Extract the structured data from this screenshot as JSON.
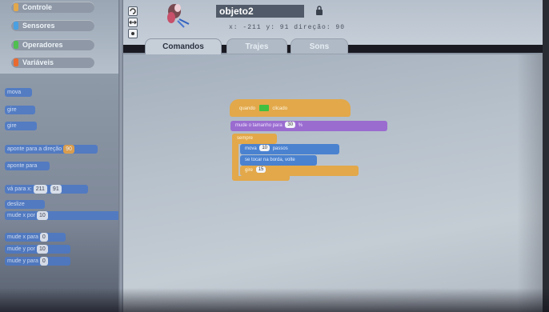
{
  "palette": {
    "categories": [
      {
        "label": "Controle",
        "color": "#e2a84a"
      },
      {
        "label": "Sensores",
        "color": "#4aa0e0"
      },
      {
        "label": "Operadores",
        "color": "#50c050"
      },
      {
        "label": "Variáveis",
        "color": "#e86a30"
      }
    ],
    "blocks": [
      {
        "label": "mova"
      },
      {
        "label": "gire"
      },
      {
        "label": "gire"
      },
      {
        "label": "aponte para a direção",
        "value": "90"
      },
      {
        "label": "aponte para"
      },
      {
        "label": "vá para x:",
        "value": "211",
        "value2": "91"
      },
      {
        "label": "deslize"
      },
      {
        "label": "mude x por",
        "value": "10"
      },
      {
        "label": "mude x para",
        "value": "0"
      },
      {
        "label": "mude y por",
        "value": "10"
      },
      {
        "label": "mude y para",
        "value": "0"
      }
    ]
  },
  "header": {
    "sprite_name": "objeto2",
    "coords_text": "x: -211  y: 91   direção: 90"
  },
  "tabs": [
    {
      "label": "Comandos",
      "active": true
    },
    {
      "label": "Trajes",
      "active": false
    },
    {
      "label": "Sons",
      "active": false
    }
  ],
  "script": {
    "hat_label": "quando",
    "hat_suffix": "clicado",
    "set_size_label": "mude o tamanho para",
    "set_size_value": "30",
    "set_size_unit": "%",
    "forever_label": "sempre",
    "move_label": "mova",
    "move_value": "10",
    "move_suffix": "passos",
    "bounce_label": "se tocar na borda, volte",
    "turn_label": "gire",
    "turn_value": "15"
  },
  "colors": {
    "control": "#e2a84a",
    "looks": "#9a6cd0",
    "motion": "#4a82d0",
    "flag": "#40c040",
    "sprite_name_bg": "#505a68"
  }
}
